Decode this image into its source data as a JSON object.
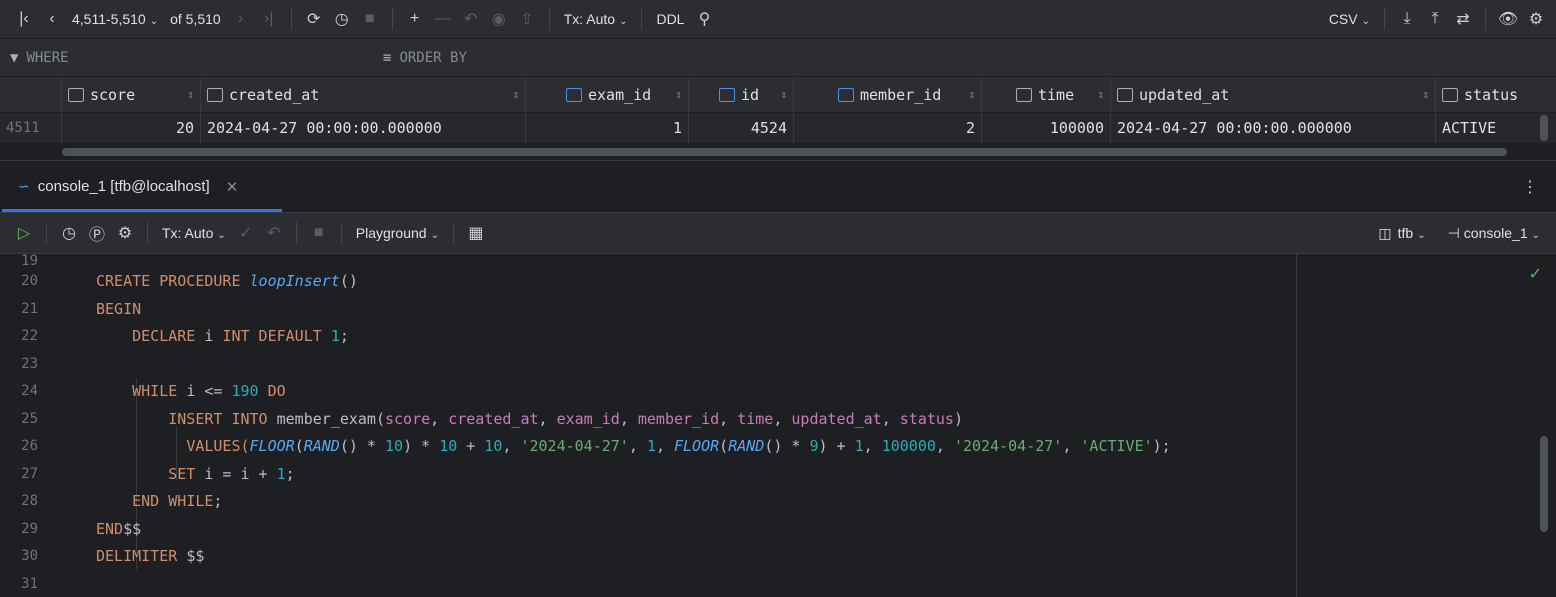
{
  "grid_toolbar": {
    "page_range": "4,511-5,510",
    "page_total": "of 5,510",
    "tx_mode": "Tx: Auto",
    "ddl_label": "DDL",
    "export_format": "CSV"
  },
  "filter": {
    "where_label": "WHERE",
    "order_label": "ORDER BY"
  },
  "grid": {
    "columns": [
      "score",
      "created_at",
      "exam_id",
      "id",
      "member_id",
      "time",
      "updated_at",
      "status"
    ],
    "row_number": "4511",
    "row": [
      "20",
      "2024-04-27 00:00:00.000000",
      "1",
      "4524",
      "2",
      "100000",
      "2024-04-27 00:00:00.000000",
      "ACTIVE"
    ]
  },
  "console_tab": {
    "title": "console_1 [tfb@localhost]"
  },
  "editor_toolbar": {
    "tx_mode": "Tx: Auto",
    "playground_label": "Playground",
    "schema_label": "tfb",
    "session_label": "console_1"
  },
  "editor": {
    "line_numbers": [
      "19",
      "20",
      "21",
      "22",
      "23",
      "24",
      "25",
      "26",
      "27",
      "28",
      "29",
      "30",
      "31"
    ],
    "code": {
      "l20_kw": "CREATE PROCEDURE ",
      "l20_fn": "loopInsert",
      "l20_rest": "()",
      "l21": "BEGIN",
      "l22_kw": "DECLARE ",
      "l22_id": "i ",
      "l22_kw2": "INT DEFAULT ",
      "l22_num": "1",
      "l22_end": ";",
      "l24_kw": "WHILE ",
      "l24_mid": "i <= ",
      "l24_num": "190",
      "l24_kw2": " DO",
      "l25_kw": "INSERT INTO ",
      "l25_tbl": "member_exam(",
      "l25_cols": [
        "score",
        "created_at",
        "exam_id",
        "member_id",
        "time",
        "updated_at",
        "status"
      ],
      "l26_kw": "VALUES(",
      "l26_floor": "FLOOR",
      "l26_rand": "RAND",
      "l26_num10": "10",
      "l26_date": "'2024-04-27'",
      "l26_one": "1",
      "l26_nine": "9",
      "l26_time": "100000",
      "l26_status": "'ACTIVE'",
      "l27_kw": "SET ",
      "l27_rest": "i = i + ",
      "l27_num": "1",
      "l28_kw": "END WHILE",
      "l29_kw": "END",
      "l29_rest": "$$",
      "l30_kw": "DELIMITER ",
      "l30_rest": "$$"
    }
  }
}
